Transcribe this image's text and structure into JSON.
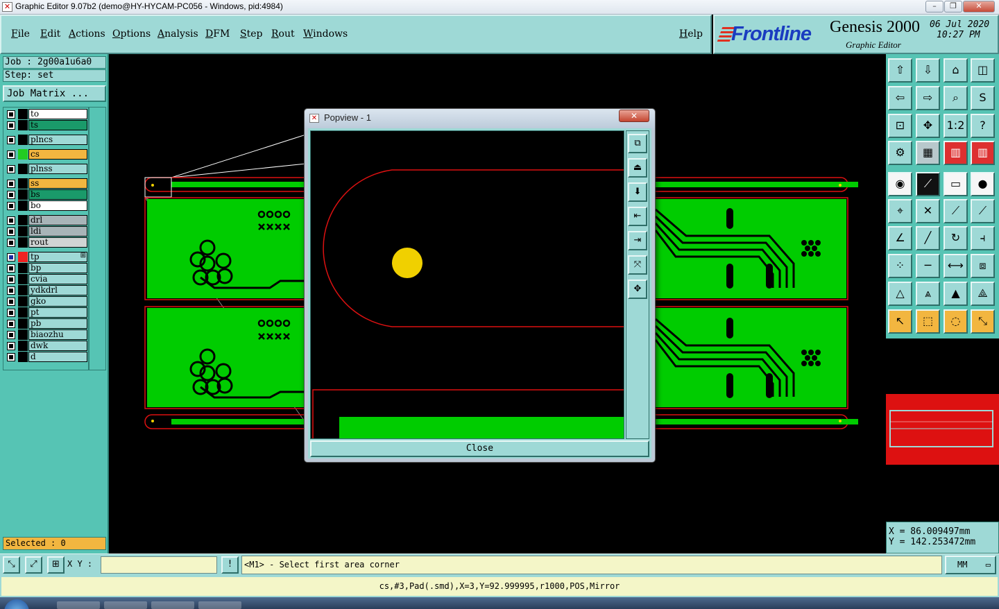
{
  "window": {
    "title": "Graphic Editor 9.07b2 (demo@HY-HYCAM-PC056 - Windows, pid:4984)",
    "min_glyph": "–",
    "max_glyph": "❐",
    "close_glyph": "✕",
    "app_icon": "✕"
  },
  "menu": {
    "items": [
      "File",
      "Edit",
      "Actions",
      "Options",
      "Analysis",
      "DFM",
      "Step",
      "Rout",
      "Windows"
    ],
    "help": "Help"
  },
  "logo": {
    "brand": "Frontline",
    "product": "Genesis 2000",
    "subtitle": "Graphic Editor",
    "date": "06 Jul 2020",
    "time": "10:27 PM"
  },
  "left": {
    "job": "Job : 2g00a1u6a0",
    "step": "Step: set",
    "job_matrix": "Job Matrix ...",
    "selected": "Selected : 0",
    "layers": [
      {
        "name": "to",
        "bg": "#ffffff",
        "swatch": "#000000"
      },
      {
        "name": "ts",
        "bg": "#1a9a6a",
        "swatch": "#000000"
      },
      {
        "name": "plncs",
        "bg": "#9ed9d6",
        "swatch": "#000000"
      },
      {
        "name": "cs",
        "bg": "#f2b640",
        "swatch": "#22cc22"
      },
      {
        "name": "plnss",
        "bg": "#9ed9d6",
        "swatch": "#000000"
      },
      {
        "name": "ss",
        "bg": "#f2b640",
        "swatch": "#000000"
      },
      {
        "name": "bs",
        "bg": "#1a9a6a",
        "swatch": "#000000"
      },
      {
        "name": "bo",
        "bg": "#ffffff",
        "swatch": "#000000"
      },
      {
        "name": "drl",
        "bg": "#a8b4b8",
        "swatch": "#000000"
      },
      {
        "name": "ldi",
        "bg": "#a8b4b8",
        "swatch": "#000000"
      },
      {
        "name": "rout",
        "bg": "#d0d4d4",
        "swatch": "#000000"
      },
      {
        "name": "tp",
        "bg": "#9ed9d6",
        "swatch": "#ee2222",
        "marker": "⊞"
      },
      {
        "name": "bp",
        "bg": "#9ed9d6",
        "swatch": "#000000"
      },
      {
        "name": "cvia",
        "bg": "#9ed9d6",
        "swatch": "#000000"
      },
      {
        "name": "ydkdrl",
        "bg": "#9ed9d6",
        "swatch": "#000000"
      },
      {
        "name": "gko",
        "bg": "#9ed9d6",
        "swatch": "#000000"
      },
      {
        "name": "pt",
        "bg": "#9ed9d6",
        "swatch": "#000000"
      },
      {
        "name": "pb",
        "bg": "#9ed9d6",
        "swatch": "#000000"
      },
      {
        "name": "biaozhu",
        "bg": "#9ed9d6",
        "swatch": "#000000"
      },
      {
        "name": "dwk",
        "bg": "#9ed9d6",
        "swatch": "#000000"
      },
      {
        "name": "d",
        "bg": "#9ed9d6",
        "swatch": "#000000"
      }
    ]
  },
  "popview": {
    "title": "Popview - 1",
    "close_label": "Close",
    "close_glyph": "✕",
    "tools": [
      {
        "icon": "zoom-window-icon",
        "glyph": "⧉"
      },
      {
        "icon": "pan-up-icon",
        "glyph": "⏏"
      },
      {
        "icon": "pan-down-icon",
        "glyph": "⬇"
      },
      {
        "icon": "pan-left-icon",
        "glyph": "⇤"
      },
      {
        "icon": "pan-right-icon",
        "glyph": "⇥"
      },
      {
        "icon": "zoom-out-icon",
        "glyph": "⤧"
      },
      {
        "icon": "zoom-in-icon",
        "glyph": "✥"
      }
    ]
  },
  "toolbar": {
    "tools": [
      {
        "icon": "pan-up-icon",
        "glyph": "⇧",
        "style": ""
      },
      {
        "icon": "pan-down-icon",
        "glyph": "⇩",
        "style": ""
      },
      {
        "icon": "home-icon",
        "glyph": "⌂",
        "style": ""
      },
      {
        "icon": "window-icon",
        "glyph": "◫",
        "style": ""
      },
      {
        "icon": "pan-left-icon",
        "glyph": "⇦",
        "style": ""
      },
      {
        "icon": "pan-right-icon",
        "glyph": "⇨",
        "style": ""
      },
      {
        "icon": "zoom-box-icon",
        "glyph": "⌕",
        "style": ""
      },
      {
        "icon": "redraw-icon",
        "glyph": "S",
        "style": ""
      },
      {
        "icon": "fit-icon",
        "glyph": "⊡",
        "style": ""
      },
      {
        "icon": "zoom-in-icon",
        "glyph": "✥",
        "style": ""
      },
      {
        "icon": "one-to-two-icon",
        "glyph": "1:2",
        "style": ""
      },
      {
        "icon": "help-icon",
        "glyph": "?",
        "style": ""
      },
      {
        "icon": "snap-settings-icon",
        "glyph": "⚙",
        "style": ""
      },
      {
        "icon": "grid-icon",
        "glyph": "▦",
        "style": "gray"
      },
      {
        "icon": "layers-red-icon",
        "glyph": "▥",
        "style": "red"
      },
      {
        "icon": "layers-red-alt-icon",
        "glyph": "▥",
        "style": "red"
      },
      {
        "icon": "pad-icon",
        "glyph": "◉",
        "style": "white"
      },
      {
        "icon": "line-dark-icon",
        "glyph": "⟋",
        "style": "dark"
      },
      {
        "icon": "ruler-icon",
        "glyph": "▭",
        "style": "white"
      },
      {
        "icon": "circle-icon",
        "glyph": "●",
        "style": "white"
      },
      {
        "icon": "connect-icon",
        "glyph": "⌖",
        "style": ""
      },
      {
        "icon": "cross-icon",
        "glyph": "✕",
        "style": ""
      },
      {
        "icon": "slope-icon",
        "glyph": "⟋",
        "style": ""
      },
      {
        "icon": "slope-red-icon",
        "glyph": "⟋",
        "style": ""
      },
      {
        "icon": "angle-icon",
        "glyph": "∠",
        "style": ""
      },
      {
        "icon": "diagonal-icon",
        "glyph": "╱",
        "style": ""
      },
      {
        "icon": "arc-icon",
        "glyph": "↻",
        "style": ""
      },
      {
        "icon": "split-icon",
        "glyph": "⫞",
        "style": ""
      },
      {
        "icon": "nodes-icon",
        "glyph": "⁘",
        "style": ""
      },
      {
        "icon": "horizontal-line-icon",
        "glyph": "─",
        "style": ""
      },
      {
        "icon": "measure-icon",
        "glyph": "⟷",
        "style": ""
      },
      {
        "icon": "shapes-icon",
        "glyph": "⧈",
        "style": ""
      },
      {
        "icon": "triangle-icon",
        "glyph": "△",
        "style": ""
      },
      {
        "icon": "triangle-up-icon",
        "glyph": "⩓",
        "style": ""
      },
      {
        "icon": "triangle-bold-icon",
        "glyph": "▲",
        "style": ""
      },
      {
        "icon": "triangle-split-icon",
        "glyph": "⟁",
        "style": ""
      },
      {
        "icon": "pointer-icon",
        "glyph": "↖",
        "style": "orange"
      },
      {
        "icon": "select-box-icon",
        "glyph": "⬚",
        "style": "orange"
      },
      {
        "icon": "select-circle-icon",
        "glyph": "◌",
        "style": "orange"
      },
      {
        "icon": "select-move-icon",
        "glyph": "⤡",
        "style": "orange"
      }
    ]
  },
  "coords": {
    "x": "X  = 86.009497mm",
    "y": "Y  = 142.253472mm"
  },
  "cmdbar": {
    "xy_label": "X Y :",
    "xy_value": "",
    "warn_glyph": "!",
    "prompt": "<M1> - Select first area corner",
    "units": "MM",
    "units_arrow": "▭",
    "buttons": [
      {
        "icon": "zoom-area-icon",
        "glyph": "⤡"
      },
      {
        "icon": "zoom-edit-icon",
        "glyph": "⤢"
      },
      {
        "icon": "grid-snap-icon",
        "glyph": "⊞"
      }
    ]
  },
  "status": {
    "text": "cs,#3,Pad(.smd),X=3,Y=92.999995,r1000,POS,Mirror"
  },
  "colors": {
    "board": "#00cc00",
    "outline": "#dd1111",
    "pad": "#f0d000",
    "teal": "#9ed9d6",
    "panel": "#56c4b4"
  }
}
